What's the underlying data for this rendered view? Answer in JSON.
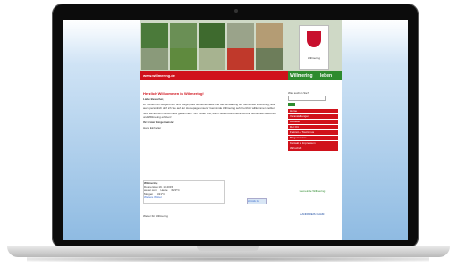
{
  "site": {
    "url": "www.willmering.de",
    "brand_part1": "Willmering",
    "brand_part2": "leben",
    "crest_label": "Willmering",
    "welcome": "Herzlich Willkommen in Willmering!",
    "greeting": "Liebe Besucher,",
    "para1": "im Namen der Bürgerinnen und Bürger, des Gemeinderates und der Verwaltung der Gemeinde Willmering, aber auch persönlich darf ich Sie auf der Homepage unserer Gemeinde Willmering sehr herzlich willkommen heißen.",
    "para2": "Sind sie auf den Geschmack gekommen? Wir freuen uns, wenn Sie einmal unsere schöne Gemeinde besuchen und Willmering erleben!",
    "closing": "Ihr Erster Bürgermeister",
    "signature": "Hans Einhellier",
    "weather": {
      "place": "Willmering",
      "date": "Donnerstag 19. 10.2015",
      "provider": "wetter.com",
      "today_label": "Heute",
      "today_temp": "6/23°C",
      "tomorrow_label": "Morgen",
      "tomorrow_temp": "9/21°C",
      "link": "Weitere Wetter"
    },
    "footer_link": "Wetter für Willmering",
    "back_link": "zurück zu",
    "search_label": "Was suchen Sie?",
    "menu": [
      "Home",
      "Veranstaltungen",
      "Aktuelles",
      "Der Ort",
      "Freizeit & Tourismus",
      "Bürgerservice",
      "Kontakt & Impressum",
      "Wirtschaft"
    ],
    "logo1_text": "Gemeinde Willmering",
    "logo2_text": "LANDKREIS CHAM"
  }
}
